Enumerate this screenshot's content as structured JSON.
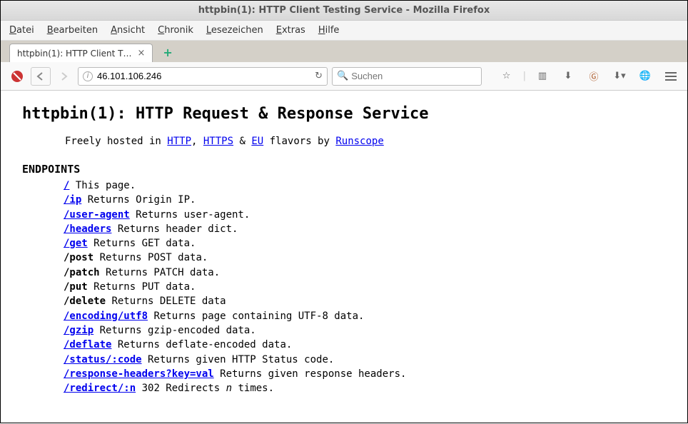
{
  "window": {
    "title": "httpbin(1): HTTP Client Testing Service - Mozilla Firefox"
  },
  "menu": {
    "datei": "Datei",
    "bearbeiten": "Bearbeiten",
    "ansicht": "Ansicht",
    "chronik": "Chronik",
    "lesezeichen": "Lesezeichen",
    "extras": "Extras",
    "hilfe": "Hilfe"
  },
  "tab": {
    "title": "httpbin(1): HTTP Client T…"
  },
  "urlbar": {
    "value": "46.101.106.246"
  },
  "search": {
    "placeholder": "Suchen"
  },
  "page": {
    "heading": "httpbin(1): HTTP Request & Response Service",
    "subtitle_pre": "Freely hosted in ",
    "link_http": "HTTP",
    "comma": ", ",
    "link_https": "HTTPS",
    "amp": " & ",
    "link_eu": "EU",
    "flavors": " flavors by ",
    "link_runscope": "Runscope",
    "endpoints_head": "ENDPOINTS",
    "ep": [
      {
        "path": "/",
        "desc": " This page.",
        "link": true
      },
      {
        "path": "/ip",
        "desc": " Returns Origin IP.",
        "link": true
      },
      {
        "path": "/user-agent",
        "desc": " Returns user-agent.",
        "link": true
      },
      {
        "path": "/headers",
        "desc": " Returns header dict.",
        "link": true
      },
      {
        "path": "/get",
        "desc": " Returns GET data.",
        "link": true
      },
      {
        "path": "/post",
        "desc": " Returns POST data.",
        "link": false
      },
      {
        "path": "/patch",
        "desc": " Returns PATCH data.",
        "link": false
      },
      {
        "path": "/put",
        "desc": " Returns PUT data.",
        "link": false
      },
      {
        "path": "/delete",
        "desc": " Returns DELETE data",
        "link": false
      },
      {
        "path": "/encoding/utf8",
        "desc": " Returns page containing UTF-8 data.",
        "link": true
      },
      {
        "path": "/gzip",
        "desc": " Returns gzip-encoded data.",
        "link": true
      },
      {
        "path": "/deflate",
        "desc": " Returns deflate-encoded data.",
        "link": true
      },
      {
        "path": "/status/:code",
        "desc": " Returns given HTTP Status code.",
        "link": true
      },
      {
        "path": "/response-headers?key=val",
        "desc": " Returns given response headers.",
        "link": true
      },
      {
        "path": "/redirect/:n",
        "desc_pre": " 302 Redirects ",
        "italic": "n",
        "desc_post": " times.",
        "link": true
      }
    ]
  }
}
